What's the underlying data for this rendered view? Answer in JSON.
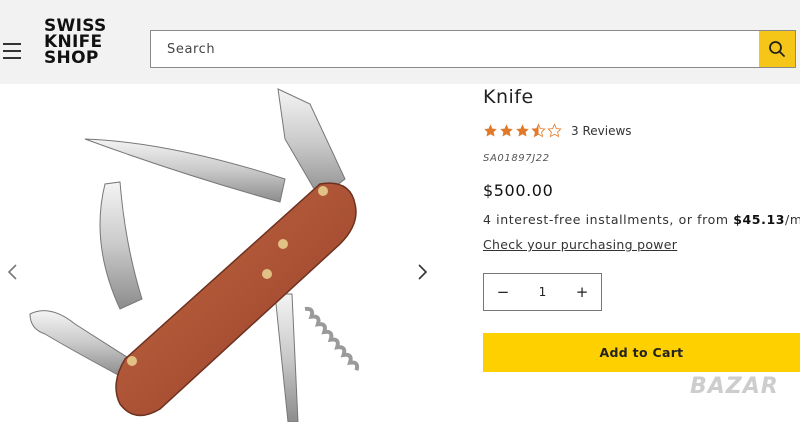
{
  "header": {
    "logo_line1": "SWISS",
    "logo_line2": "KNIFE",
    "logo_line3": "SHOP",
    "search_placeholder": "Search"
  },
  "product": {
    "title": "Knife",
    "rating": 3.5,
    "reviews_label": "3 Reviews",
    "sku": "SA01897J22",
    "price": "$500.00",
    "installments_text": "4 interest-free installments, or from ",
    "installments_amount": "$45.13",
    "installments_suffix": "/mo",
    "purchasing_link": "Check your purchasing power",
    "quantity": "1",
    "qty_minus": "−",
    "qty_plus": "+",
    "add_to_cart": "Add to Cart"
  },
  "watermark": "BAZAR",
  "colors": {
    "accent": "#ffd000",
    "star": "#e07a2a",
    "logo_cross": "#e30613"
  }
}
